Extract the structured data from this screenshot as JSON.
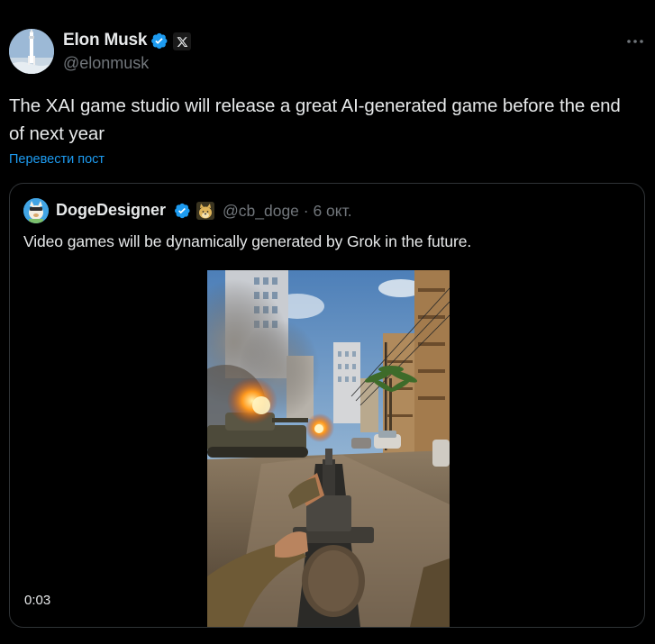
{
  "post": {
    "author_name": "Elon Musk",
    "author_handle": "@elonmusk",
    "text": "The XAI game studio will release a great AI-generated game before the end of next year",
    "translate_label": "Перевести пост"
  },
  "quote": {
    "author_name": "DogeDesigner",
    "meta": "@cb_doge · 6 окт.",
    "text": "Video games will be dynamically generated by Grok in the future.",
    "video_time": "0:03"
  },
  "icons": {
    "verified": "verified-badge-icon",
    "x_affiliate": "x-logo-icon",
    "more": "more-dots-icon",
    "doge_affiliate": "doge-icon"
  },
  "colors": {
    "background": "#000000",
    "text": "#e7e9ea",
    "muted": "#71767b",
    "link": "#1d9bf0",
    "verified": "#1d9bf0",
    "border": "#2f3336"
  }
}
